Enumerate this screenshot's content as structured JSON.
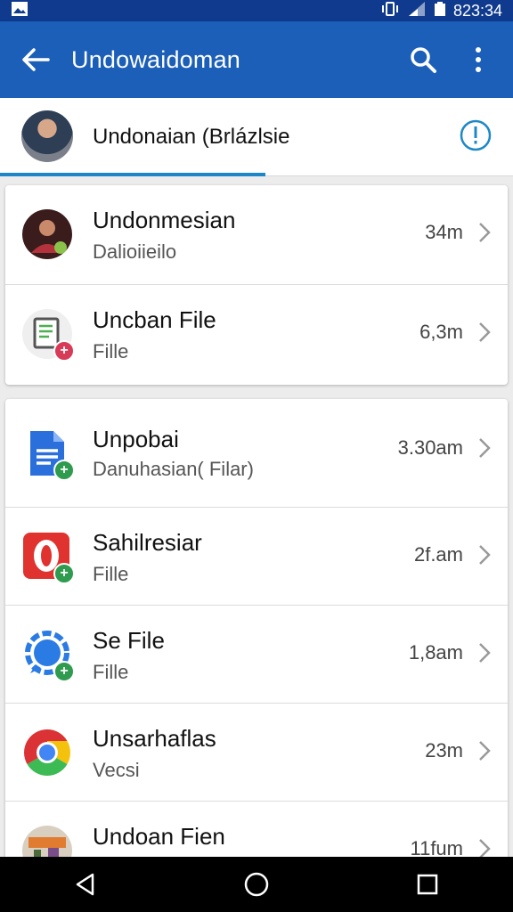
{
  "status_bar": {
    "time": "823:34"
  },
  "app_bar": {
    "title": "Undowaidoman",
    "back_icon": "arrow-back-icon",
    "search_icon": "search-icon",
    "more_icon": "more-vert-icon"
  },
  "header": {
    "title": "Undonaian (Brlázlsie",
    "info_icon": "info-icon"
  },
  "group1": [
    {
      "title": "Undonmesian",
      "subtitle": "Dalioiieilo",
      "meta": "34m",
      "icon": "contact-avatar"
    },
    {
      "title": "Uncban File",
      "subtitle": "Fille",
      "meta": "6,3m",
      "icon": "document-icon"
    }
  ],
  "group2": [
    {
      "title": "Unpobai",
      "subtitle": "Danuhasian( Filar)",
      "meta": "3.30am",
      "icon": "google-docs-icon"
    },
    {
      "title": "Sahilresiar",
      "subtitle": "Fille",
      "meta": "2f.am",
      "icon": "opera-icon"
    },
    {
      "title": "Se File",
      "subtitle": "Fille",
      "meta": "1,8am",
      "icon": "signal-chat-icon"
    },
    {
      "title": "Unsarhaflas",
      "subtitle": "Vecsi",
      "meta": "23m",
      "icon": "chrome-icon"
    },
    {
      "title": "Undoan Fien",
      "subtitle": "",
      "meta": "11fum",
      "icon": "photo-thumbnail"
    }
  ],
  "nav_bar": {
    "back": "back-triangle-icon",
    "home": "home-circle-icon",
    "recents": "recents-square-icon"
  }
}
